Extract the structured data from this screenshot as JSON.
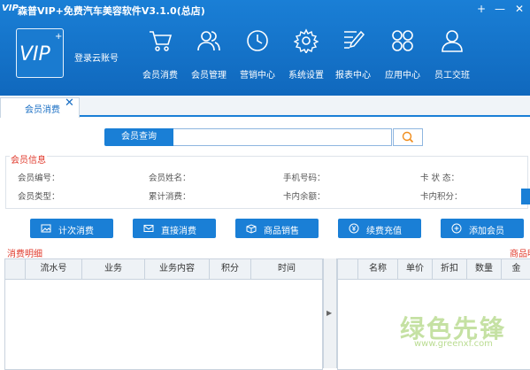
{
  "app": {
    "logo_mark": "VIP",
    "title": "森普VIP+免费汽车美容软件V3.1.0(总店)",
    "window_controls": [
      "+",
      "—",
      "✕"
    ]
  },
  "sidebar_logo": {
    "text": "VIP",
    "plus": "+",
    "login_label": "登录云账号"
  },
  "nav": [
    {
      "label": "会员消费",
      "icon": "cart-icon"
    },
    {
      "label": "会员管理",
      "icon": "users-icon"
    },
    {
      "label": "营销中心",
      "icon": "clock-icon"
    },
    {
      "label": "系统设置",
      "icon": "gear-icon"
    },
    {
      "label": "报表中心",
      "icon": "report-pen-icon"
    },
    {
      "label": "应用中心",
      "icon": "apps-grid-icon"
    },
    {
      "label": "员工交班",
      "icon": "person-icon"
    }
  ],
  "tabs": [
    {
      "label": "会员消费",
      "close": "✕"
    }
  ],
  "search": {
    "button_label": "会员查询",
    "value": "",
    "placeholder": ""
  },
  "member_info": {
    "title": "会员信息",
    "fields": [
      [
        "会员编号：",
        "会员姓名：",
        "手机号码：",
        "卡 状 态："
      ],
      [
        "会员类型：",
        "累计消费：",
        "卡内余额：",
        "卡内积分："
      ]
    ]
  },
  "actions": [
    {
      "label": "计次消费",
      "icon": "image-icon"
    },
    {
      "label": "直接消费",
      "icon": "mail-icon"
    },
    {
      "label": "商品销售",
      "icon": "box-icon"
    },
    {
      "label": "续费充值",
      "icon": "coin-icon"
    },
    {
      "label": "添加会员",
      "icon": "plus-circle-icon"
    }
  ],
  "consume_detail": {
    "title": "消费明细",
    "columns": [
      "",
      "流水号",
      "业务",
      "业务内容",
      "积分",
      "时间"
    ]
  },
  "product_detail": {
    "title": "商品明",
    "columns": [
      "",
      "名称",
      "单价",
      "折扣",
      "数量",
      "金"
    ]
  },
  "watermark": {
    "text": "绿色先锋",
    "url": "www.greenxf.com"
  },
  "colors": {
    "brand_blue": "#1a7fd6",
    "section_red": "#e03a2c"
  }
}
